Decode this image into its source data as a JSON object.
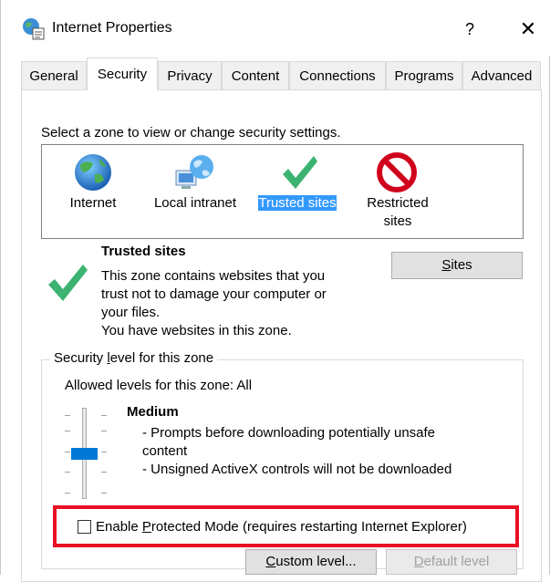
{
  "window": {
    "title": "Internet Properties",
    "help": "?",
    "close": "✕"
  },
  "tabs": [
    {
      "label": "General"
    },
    {
      "label": "Security"
    },
    {
      "label": "Privacy"
    },
    {
      "label": "Content"
    },
    {
      "label": "Connections"
    },
    {
      "label": "Programs"
    },
    {
      "label": "Advanced"
    }
  ],
  "zone_prompt": "Select a zone to view or change security settings.",
  "zones": [
    {
      "label": "Internet",
      "icon": "globe-icon"
    },
    {
      "label": "Local intranet",
      "icon": "network-globe-icon"
    },
    {
      "label": "Trusted sites",
      "icon": "checkmark-icon",
      "selected": true
    },
    {
      "label_line1": "Restricted",
      "label_line2": "sites",
      "icon": "no-entry-icon"
    }
  ],
  "zone_info": {
    "title": "Trusted sites",
    "lines": [
      "This zone contains websites that you",
      "trust not to damage your computer or",
      "your files.",
      "You have websites in this zone."
    ],
    "sites_button_prefix": "",
    "sites_button_u": "S",
    "sites_button_rest": "ites"
  },
  "security_level": {
    "legend_pre": "Security ",
    "legend_u": "l",
    "legend_post": "evel for this zone",
    "allowed": "Allowed levels for this zone: All",
    "level_name": "Medium",
    "level_lines": [
      "- Prompts before downloading potentially unsafe",
      "content",
      "- Unsigned ActiveX controls will not be downloaded"
    ],
    "slider_level": "Medium"
  },
  "protected_mode": {
    "pre": "Enable ",
    "u": "P",
    "post": "rotected Mode (requires restarting Internet Explorer)",
    "checked": false
  },
  "buttons": {
    "custom_u": "C",
    "custom_rest": "ustom level...",
    "default_u": "D",
    "default_rest": "efault level"
  },
  "colors": {
    "accent": "#0078d7",
    "selection": "#3399ff",
    "highlight_border": "#e81123"
  }
}
